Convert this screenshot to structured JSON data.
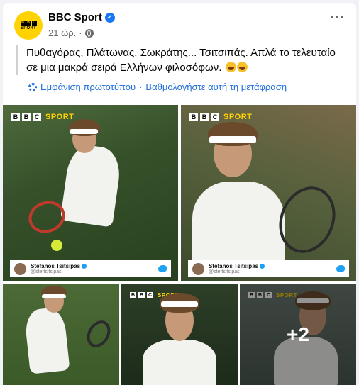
{
  "post": {
    "page_name": "BBC Sport",
    "time": "21 ώρ.",
    "separator": "·",
    "avatar_text": {
      "blocks": [
        "B",
        "B",
        "C"
      ],
      "sport": "SPORT"
    },
    "text": "Πυθαγόρας, Πλάτωνας, Σωκράτης... Τσιτσιπάς. Απλά το τελευταίο σε μια μακρά σειρά Ελλήνων φιλοσόφων.",
    "emoji": "rolling-on-the-floor-laughing",
    "translation": {
      "show_original": "Εμφάνιση πρωτοτύπου",
      "separator": "·",
      "rate": "Βαθμολογήστε αυτή τη μετάφραση"
    }
  },
  "photos": {
    "badge": {
      "blocks": [
        "B",
        "B",
        "C"
      ],
      "sport": "SPORT"
    },
    "tweet_card": {
      "name": "Stefanos Tsitsipas",
      "handle": "@steftsitsipas"
    },
    "more_count": "+2"
  },
  "colors": {
    "link": "#216fdb",
    "verified": "#1877f2",
    "bbc_yellow": "#ffd200",
    "twitter": "#1da1f2"
  }
}
